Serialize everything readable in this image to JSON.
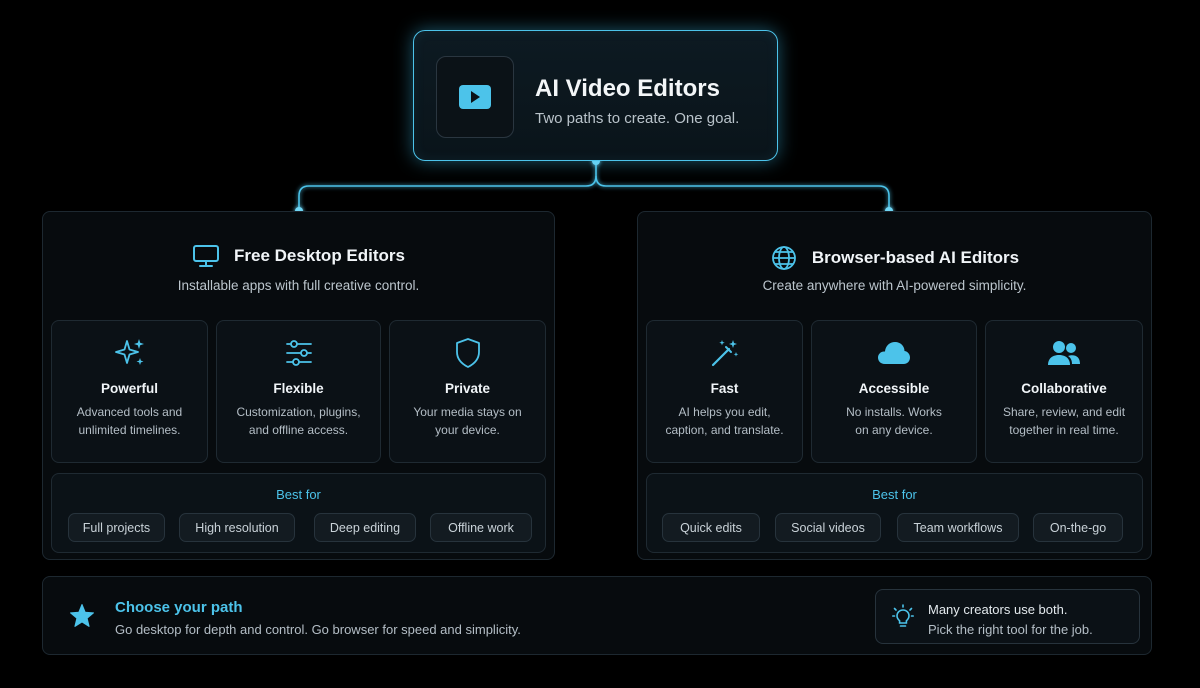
{
  "colors": {
    "accent": "#4cc3ea",
    "background": "#000000",
    "panel": "#070b0e"
  },
  "hero": {
    "icon": "video-play-icon",
    "title": "AI Video Editors",
    "subtitle": "Two paths to create. One goal."
  },
  "desktop": {
    "icon": "monitor-icon",
    "title": "Free Desktop Editors",
    "subtitle": "Installable apps with full creative control.",
    "features": [
      {
        "icon": "sparkles-icon",
        "title": "Powerful",
        "desc1": "Advanced tools and",
        "desc2": "unlimited timelines."
      },
      {
        "icon": "sliders-icon",
        "title": "Flexible",
        "desc1": "Customization, plugins,",
        "desc2": "and offline access."
      },
      {
        "icon": "shield-icon",
        "title": "Private",
        "desc1": "Your media stays on",
        "desc2": "your device."
      }
    ],
    "best_for_label": "Best for",
    "best_for": [
      "Full projects",
      "High resolution",
      "Deep editing",
      "Offline work"
    ]
  },
  "browser": {
    "icon": "globe-icon",
    "title": "Browser-based AI Editors",
    "subtitle": "Create anywhere with AI-powered simplicity.",
    "features": [
      {
        "icon": "magic-wand-icon",
        "title": "Fast",
        "desc1": "AI helps you edit,",
        "desc2": "caption, and translate."
      },
      {
        "icon": "cloud-icon",
        "title": "Accessible",
        "desc1": "No installs. Works",
        "desc2": "on any device."
      },
      {
        "icon": "users-icon",
        "title": "Collaborative",
        "desc1": "Share, review, and edit",
        "desc2": "together in real time."
      }
    ],
    "best_for_label": "Best for",
    "best_for": [
      "Quick edits",
      "Social videos",
      "Team workflows",
      "On-the-go"
    ]
  },
  "footer": {
    "icon": "star-icon",
    "title": "Choose your path",
    "subtitle": "Go desktop for depth and control. Go browser for speed and simplicity.",
    "tip_icon": "lightbulb-icon",
    "tip_line1": "Many creators use both.",
    "tip_line2": "Pick the right tool for the job."
  }
}
